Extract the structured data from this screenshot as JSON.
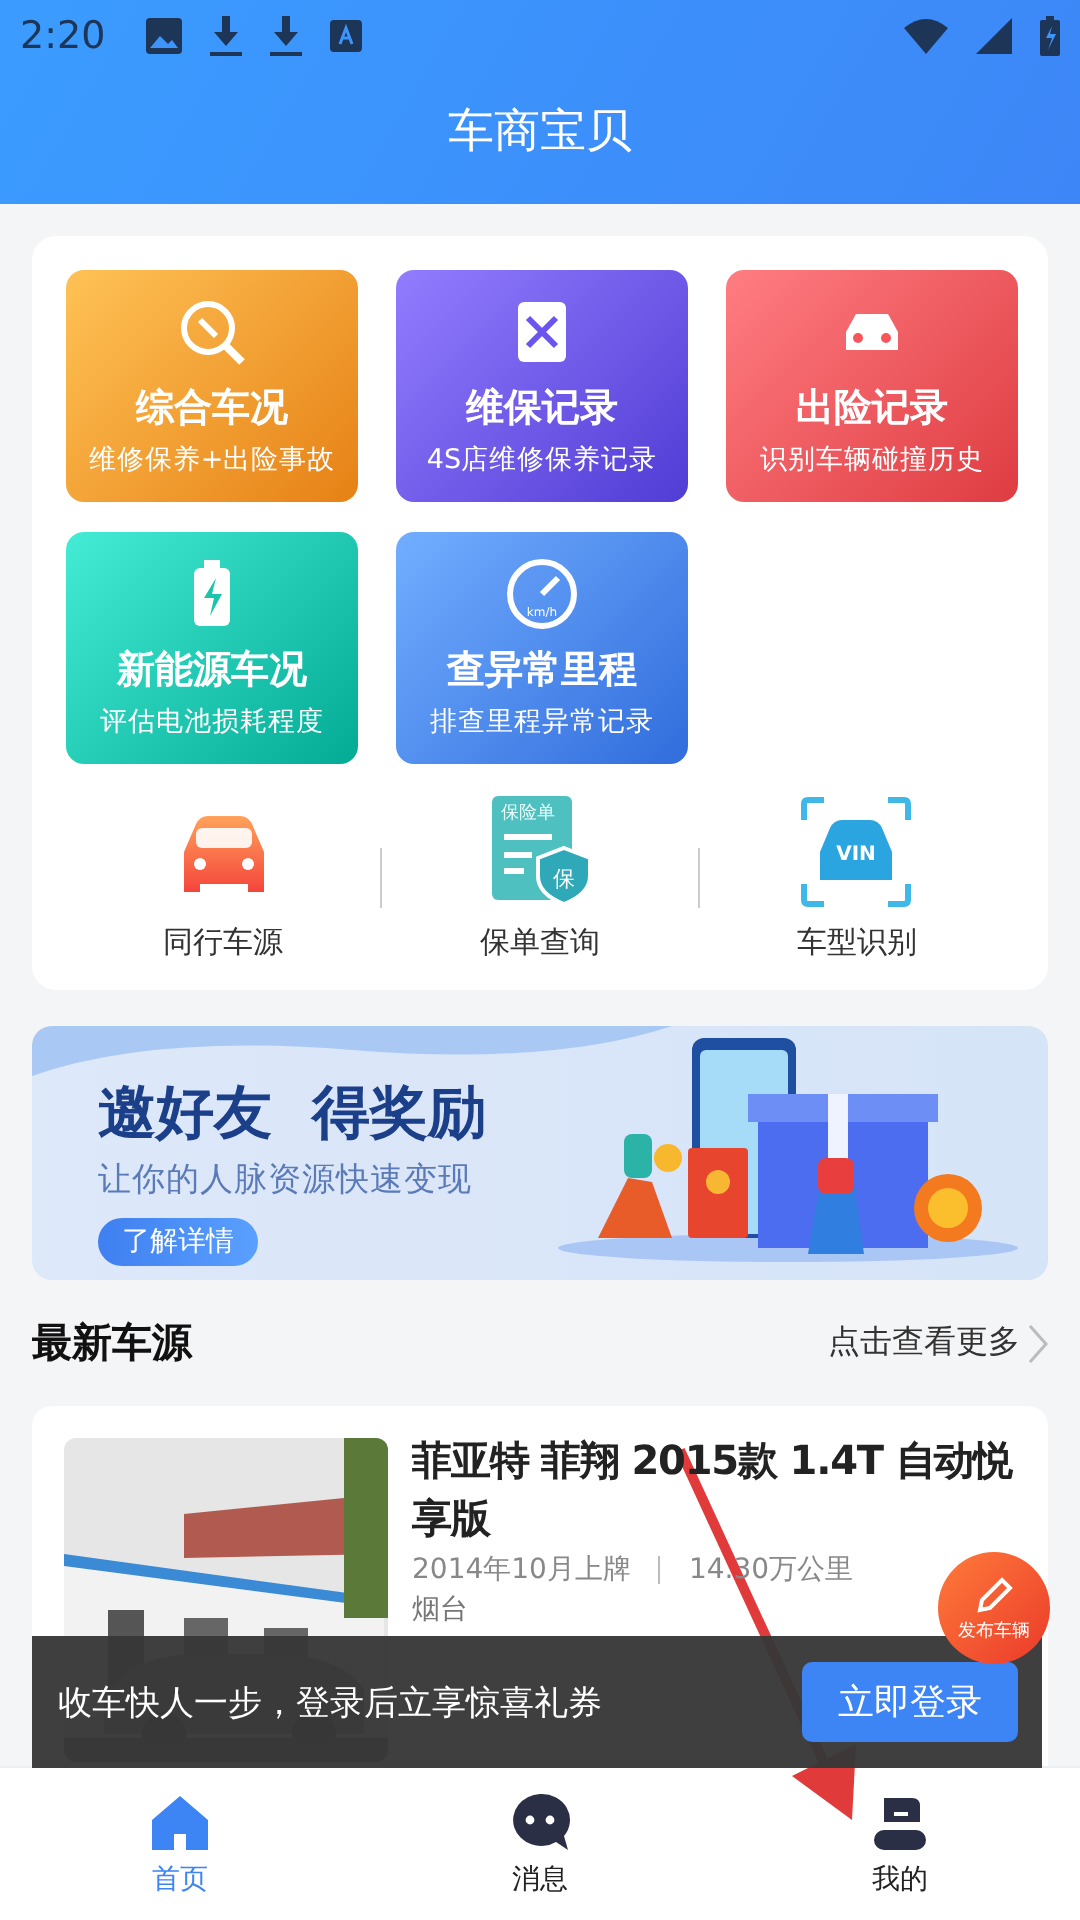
{
  "status_bar": {
    "time": "2:20"
  },
  "header": {
    "title": "车商宝贝"
  },
  "services": [
    {
      "kind": "report",
      "title": "综合车况",
      "subtitle": "维修保养+出险事故",
      "color": "#ff9a2e"
    },
    {
      "kind": "maintenance",
      "title": "维保记录",
      "subtitle": "4S店维修保养记录",
      "color": "#6a55ee"
    },
    {
      "kind": "accident",
      "title": "出险记录",
      "subtitle": "识别车辆碰撞历史",
      "color": "#f7555a"
    },
    {
      "kind": "battery",
      "title": "新能源车况",
      "subtitle": "评估电池损耗程度",
      "color": "#1cc4ae"
    },
    {
      "kind": "mileage",
      "title": "查异常里程",
      "subtitle": "排查里程异常记录",
      "color": "#4a86f5",
      "icon_text": "km/h"
    }
  ],
  "tools": [
    {
      "kind": "car",
      "label": "同行车源"
    },
    {
      "kind": "policy",
      "label": "保单查询",
      "icon_texts": [
        "保险单",
        "保"
      ]
    },
    {
      "kind": "vin",
      "label": "车型识别",
      "icon_texts": [
        "VIN"
      ]
    }
  ],
  "banner": {
    "title_parts": [
      "邀好友",
      "得奖励"
    ],
    "subtitle": "让你的人脉资源快速变现",
    "button": "了解详情"
  },
  "section": {
    "title": "最新车源",
    "more": "点击查看更多"
  },
  "listing": {
    "title": "菲亚特 菲翔 2015款 1.4T 自动悦享版",
    "registered": "2014年10月上牌",
    "mileage": "14.30万公里",
    "city": "烟台"
  },
  "fab": {
    "label": "发布车辆"
  },
  "toast": {
    "text": "收车快人一步，登录后立享惊喜礼券",
    "button": "立即登录"
  },
  "nav": [
    {
      "kind": "home",
      "label": "首页",
      "selected": true
    },
    {
      "kind": "message",
      "label": "消息",
      "selected": false
    },
    {
      "kind": "profile",
      "label": "我的",
      "selected": false
    }
  ]
}
